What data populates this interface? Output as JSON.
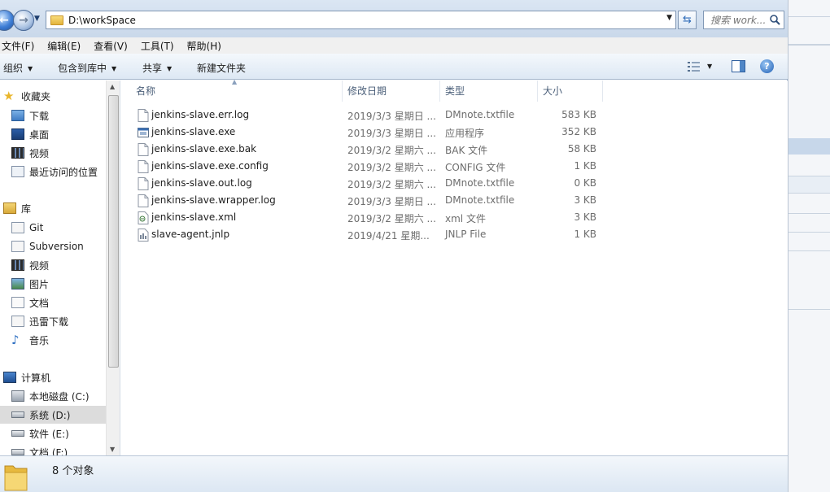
{
  "address": {
    "path": "D:\\workSpace",
    "search_placeholder": "搜索 work..."
  },
  "menu": [
    "文件(F)",
    "编辑(E)",
    "查看(V)",
    "工具(T)",
    "帮助(H)"
  ],
  "commands": {
    "organize": "组织",
    "include_library": "包含到库中",
    "share": "共享",
    "new_folder": "新建文件夹"
  },
  "nav": {
    "favorites": {
      "label": "收藏夹",
      "items": [
        "下载",
        "桌面",
        "视频",
        "最近访问的位置"
      ]
    },
    "libraries": {
      "label": "库",
      "items": [
        "Git",
        "Subversion",
        "视频",
        "图片",
        "文档",
        "迅雷下载",
        "音乐"
      ]
    },
    "computer": {
      "label": "计算机",
      "items": [
        "本地磁盘 (C:)",
        "系统 (D:)",
        "软件 (E:)",
        "文档 (F:)"
      ]
    }
  },
  "columns": [
    "名称",
    "修改日期",
    "类型",
    "大小"
  ],
  "files": [
    {
      "name": "jenkins-slave.err.log",
      "date": "2019/3/3 星期日 ...",
      "type": "DMnote.txtfile",
      "size": "583 KB",
      "icon": "text-file-icon"
    },
    {
      "name": "jenkins-slave.exe",
      "date": "2019/3/3 星期日 ...",
      "type": "应用程序",
      "size": "352 KB",
      "icon": "exe-file-icon"
    },
    {
      "name": "jenkins-slave.exe.bak",
      "date": "2019/3/2 星期六 ...",
      "type": "BAK 文件",
      "size": "58 KB",
      "icon": "blank-file-icon"
    },
    {
      "name": "jenkins-slave.exe.config",
      "date": "2019/3/2 星期六 ...",
      "type": "CONFIG 文件",
      "size": "1 KB",
      "icon": "blank-file-icon"
    },
    {
      "name": "jenkins-slave.out.log",
      "date": "2019/3/2 星期六 ...",
      "type": "DMnote.txtfile",
      "size": "0 KB",
      "icon": "text-file-icon"
    },
    {
      "name": "jenkins-slave.wrapper.log",
      "date": "2019/3/3 星期日 ...",
      "type": "DMnote.txtfile",
      "size": "3 KB",
      "icon": "text-file-icon"
    },
    {
      "name": "jenkins-slave.xml",
      "date": "2019/3/2 星期六 ...",
      "type": "xml 文件",
      "size": "3 KB",
      "icon": "xml-file-icon"
    },
    {
      "name": "slave-agent.jnlp",
      "date": "2019/4/21 星期...",
      "type": "JNLP File",
      "size": "1 KB",
      "icon": "jnlp-file-icon"
    }
  ],
  "status": {
    "count_text": "8 个对象"
  }
}
